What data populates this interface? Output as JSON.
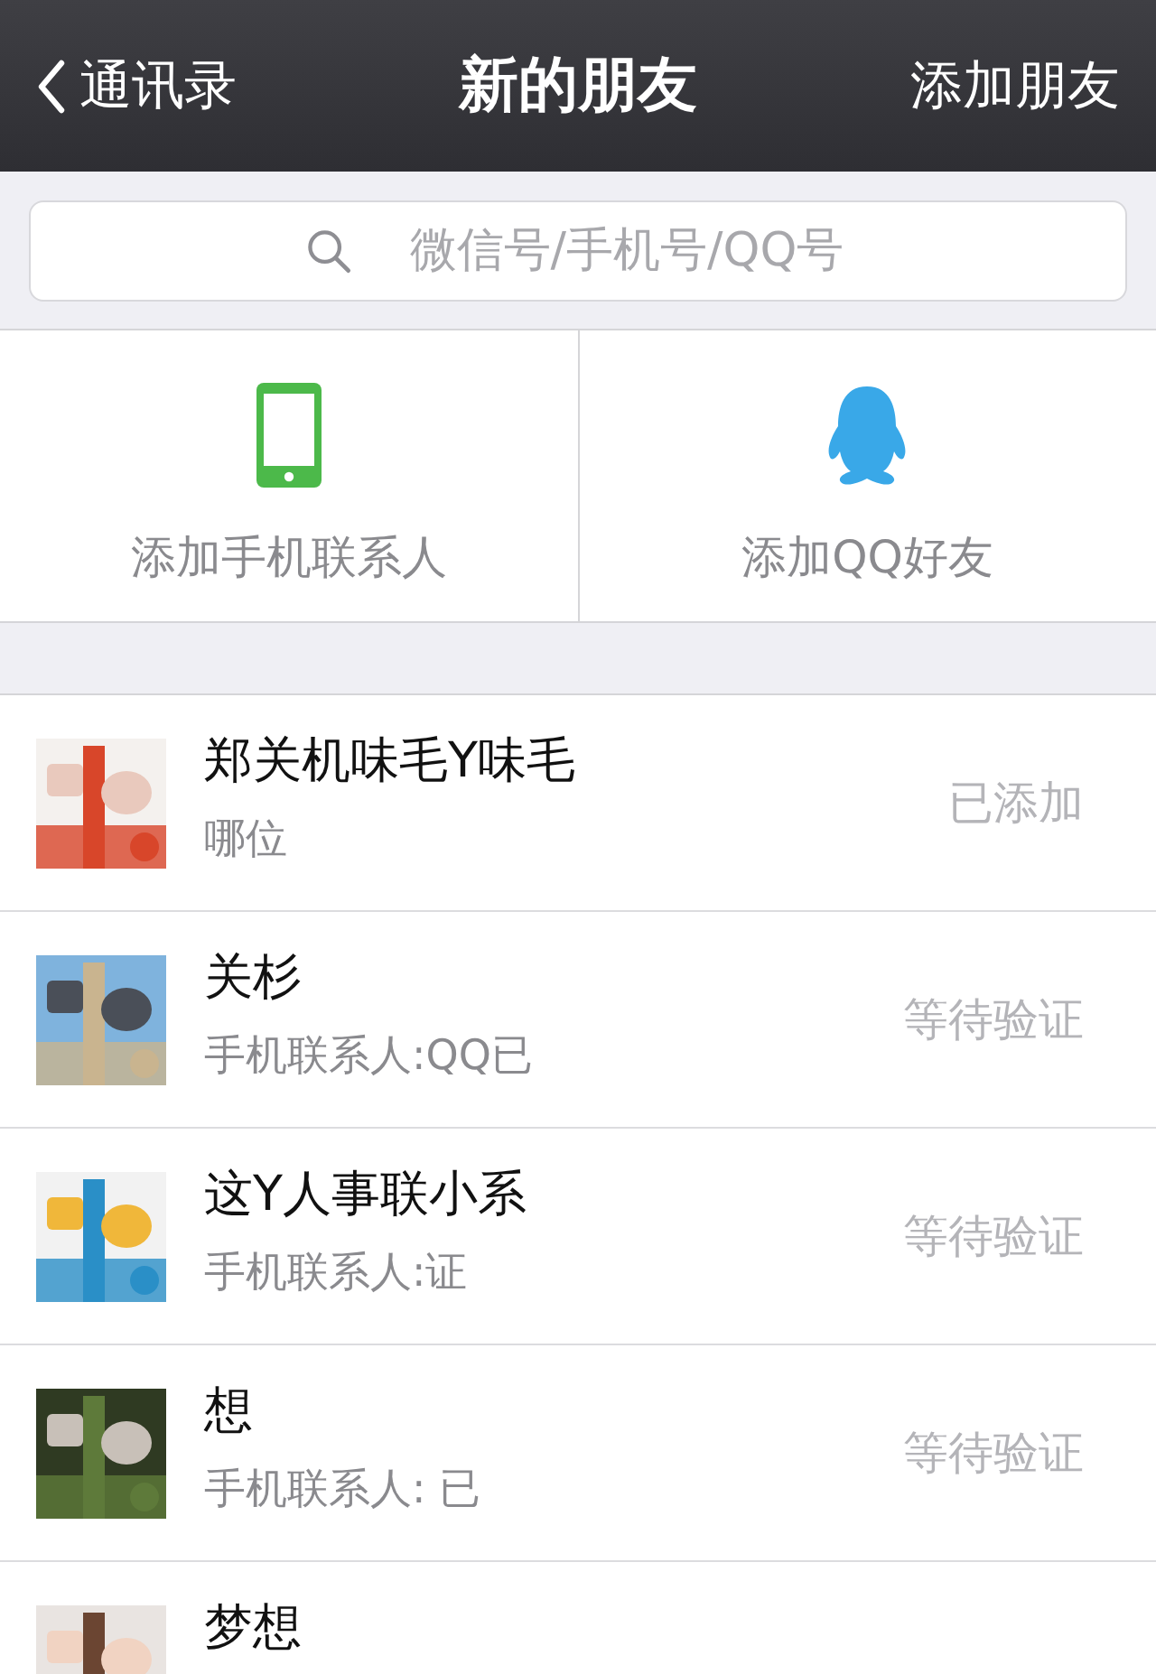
{
  "nav_bar": {
    "back_label": "通讯录",
    "title": "新的朋友",
    "action": "添加朋友"
  },
  "search": {
    "placeholder": "微信号/手机号/QQ号"
  },
  "add_options": [
    {
      "kind": "phone",
      "label": "添加手机联系人"
    },
    {
      "kind": "qq",
      "label": "添加QQ好友"
    }
  ],
  "friends": [
    {
      "name": "郑关机味毛Y味毛",
      "subtitle": "哪位",
      "status": "已添加"
    },
    {
      "name": "关杉",
      "subtitle": "手机联系人:QQ已",
      "status": "等待验证"
    },
    {
      "name": "这Y人事联小系",
      "subtitle": "手机联系人:证",
      "status": "等待验证"
    },
    {
      "name": "想",
      "subtitle": "手机联系人: 已",
      "status": "等待验证"
    },
    {
      "name": "梦想"
    }
  ]
}
